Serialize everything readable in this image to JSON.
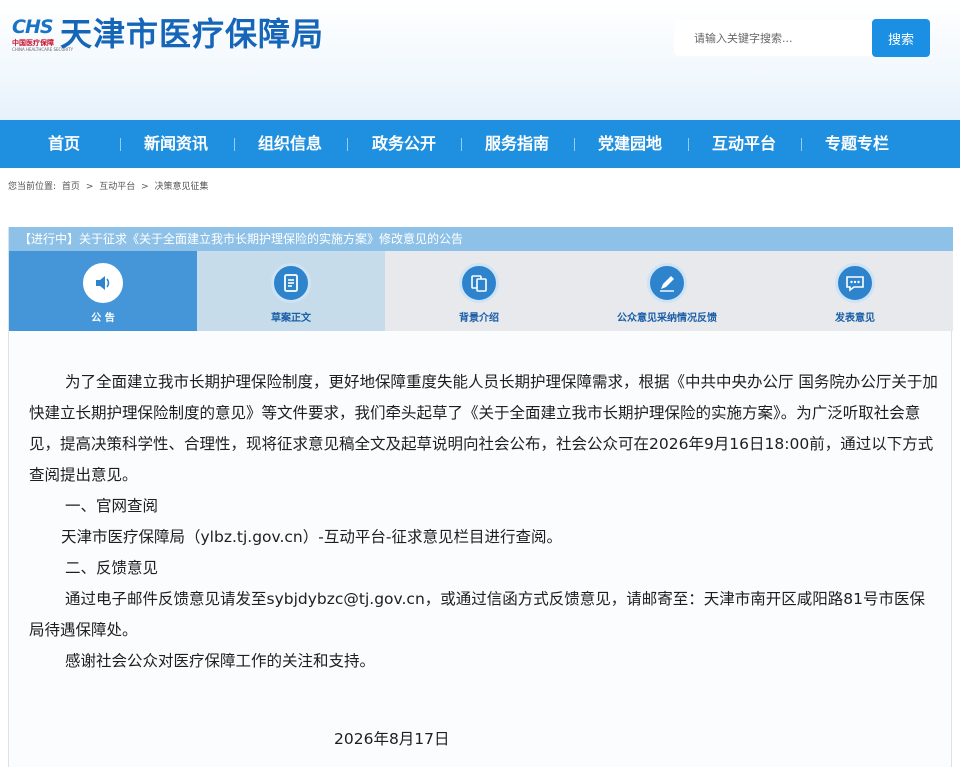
{
  "header": {
    "logo_badge": "CHS",
    "logo_badge_sub": "中国医疗保障",
    "logo_badge_en": "CHINA HEALTHCARE SECURITY",
    "site_title": "天津市医疗保障局",
    "search_placeholder": "请输入关键字搜索...",
    "search_button": "搜索"
  },
  "nav": {
    "items": [
      "首页",
      "新闻资讯",
      "组织信息",
      "政务公开",
      "服务指南",
      "党建园地",
      "互动平台",
      "专题专栏"
    ]
  },
  "breadcrumb": {
    "prefix": "您当前位置:",
    "items": [
      "首页",
      ">",
      "互动平台",
      ">",
      "决策意见征集"
    ]
  },
  "panel": {
    "title": "【进行中】关于征求《关于全面建立我市长期护理保险的实施方案》修改意见的公告",
    "tabs": [
      {
        "label": "公  告",
        "icon": "speaker-icon"
      },
      {
        "label": "草案正文",
        "icon": "document-icon"
      },
      {
        "label": "背景介绍",
        "icon": "files-icon"
      },
      {
        "label": "公众意见采纳情况反馈",
        "icon": "pen-icon"
      },
      {
        "label": "发表意见",
        "icon": "chat-icon"
      }
    ],
    "active_tab": 0
  },
  "article": {
    "intro": "为了全面建立我市长期护理保险制度，更好地保障重度失能人员长期护理保障需求，根据《中共中央办公厅 国务院办公厅关于加快建立长期护理保险制度的意见》等文件要求，我们牵头起草了《关于全面建立我市长期护理保险的实施方案》。为广泛听取社会意见，提高决策科学性、合理性，现将征求意见稿全文及起草说明向社会公布，社会公众可在2026年9月16日18:00前，通过以下方式查阅提出意见。",
    "section1_title": "一、官网查阅",
    "section1_body": "天津市医疗保障局（ylbz.tj.gov.cn）-互动平台-征求意见栏目进行查阅。",
    "section2_title": "二、反馈意见",
    "section2_body": "通过电子邮件反馈意见请发至sybjdybzc@tj.gov.cn，或通过信函方式反馈意见，请邮寄至：天津市南开区咸阳路81号市医保局待遇保障处。",
    "thanks": "感谢社会公众对医疗保障工作的关注和支持。",
    "date": "2026年8月17日"
  },
  "colors": {
    "brand_blue": "#1565b8",
    "nav_blue": "#1f8fdf",
    "panel_head": "#8ec1e8",
    "active_tab": "#4496d8"
  }
}
